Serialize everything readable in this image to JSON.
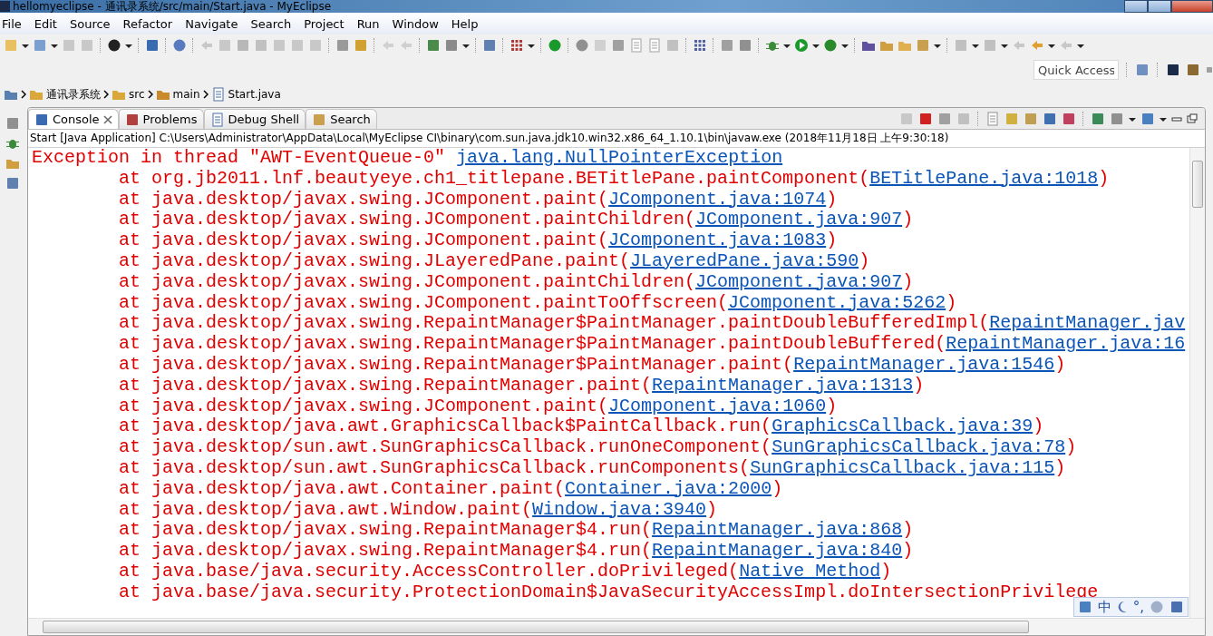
{
  "window": {
    "title": "hellomyeclipse - 通讯录系统/src/main/Start.java - MyEclipse"
  },
  "menu": [
    "File",
    "Edit",
    "Source",
    "Refactor",
    "Navigate",
    "Search",
    "Project",
    "Run",
    "Window",
    "Help"
  ],
  "quick_access": {
    "placeholder": "Quick Access"
  },
  "breadcrumb": [
    "通讯录系统",
    "src",
    "main",
    "Start.java"
  ],
  "tabs": [
    {
      "label": "Console",
      "selected": true,
      "closable": true
    },
    {
      "label": "Problems",
      "selected": false,
      "closable": false
    },
    {
      "label": "Debug Shell",
      "selected": false,
      "closable": false
    },
    {
      "label": "Search",
      "selected": false,
      "closable": false
    }
  ],
  "console": {
    "header": "Start [Java Application] C:\\Users\\Administrator\\AppData\\Local\\MyEclipse CI\\binary\\com.sun.java.jdk10.win32.x86_64_1.10.1\\bin\\javaw.exe (2018年11月18日 上午9:30:18)",
    "lines": [
      {
        "kind": "exception",
        "text": "Exception in thread \"AWT-EventQueue-0\" ",
        "link": "java.lang.NullPointerException"
      },
      {
        "kind": "frame",
        "text": "at org.jb2011.lnf.beautyeye.ch1_titlepane.BETitlePane.paintComponent(",
        "link": "BETitlePane.java:1018",
        "tail": ")"
      },
      {
        "kind": "frame",
        "text": "at java.desktop/javax.swing.JComponent.paint(",
        "link": "JComponent.java:1074",
        "tail": ")"
      },
      {
        "kind": "frame",
        "text": "at java.desktop/javax.swing.JComponent.paintChildren(",
        "link": "JComponent.java:907",
        "tail": ")"
      },
      {
        "kind": "frame",
        "text": "at java.desktop/javax.swing.JComponent.paint(",
        "link": "JComponent.java:1083",
        "tail": ")"
      },
      {
        "kind": "frame",
        "text": "at java.desktop/javax.swing.JLayeredPane.paint(",
        "link": "JLayeredPane.java:590",
        "tail": ")"
      },
      {
        "kind": "frame",
        "text": "at java.desktop/javax.swing.JComponent.paintChildren(",
        "link": "JComponent.java:907",
        "tail": ")"
      },
      {
        "kind": "frame",
        "text": "at java.desktop/javax.swing.JComponent.paintToOffscreen(",
        "link": "JComponent.java:5262",
        "tail": ")"
      },
      {
        "kind": "frame",
        "text": "at java.desktop/javax.swing.RepaintManager$PaintManager.paintDoubleBufferedImpl(",
        "link": "RepaintManager.jav"
      },
      {
        "kind": "frame",
        "text": "at java.desktop/javax.swing.RepaintManager$PaintManager.paintDoubleBuffered(",
        "link": "RepaintManager.java:16"
      },
      {
        "kind": "frame",
        "text": "at java.desktop/javax.swing.RepaintManager$PaintManager.paint(",
        "link": "RepaintManager.java:1546",
        "tail": ")"
      },
      {
        "kind": "frame",
        "text": "at java.desktop/javax.swing.RepaintManager.paint(",
        "link": "RepaintManager.java:1313",
        "tail": ")"
      },
      {
        "kind": "frame",
        "text": "at java.desktop/javax.swing.JComponent.paint(",
        "link": "JComponent.java:1060",
        "tail": ")"
      },
      {
        "kind": "frame",
        "text": "at java.desktop/java.awt.GraphicsCallback$PaintCallback.run(",
        "link": "GraphicsCallback.java:39",
        "tail": ")"
      },
      {
        "kind": "frame",
        "text": "at java.desktop/sun.awt.SunGraphicsCallback.runOneComponent(",
        "link": "SunGraphicsCallback.java:78",
        "tail": ")"
      },
      {
        "kind": "frame",
        "text": "at java.desktop/sun.awt.SunGraphicsCallback.runComponents(",
        "link": "SunGraphicsCallback.java:115",
        "tail": ")"
      },
      {
        "kind": "frame",
        "text": "at java.desktop/java.awt.Container.paint(",
        "link": "Container.java:2000",
        "tail": ")"
      },
      {
        "kind": "frame",
        "text": "at java.desktop/java.awt.Window.paint(",
        "link": "Window.java:3940",
        "tail": ")"
      },
      {
        "kind": "frame",
        "text": "at java.desktop/javax.swing.RepaintManager$4.run(",
        "link": "RepaintManager.java:868",
        "tail": ")"
      },
      {
        "kind": "frame",
        "text": "at java.desktop/javax.swing.RepaintManager$4.run(",
        "link": "RepaintManager.java:840",
        "tail": ")"
      },
      {
        "kind": "frame",
        "text": "at java.base/java.security.AccessController.doPrivileged(",
        "link": "Native Method",
        "tail": ")"
      },
      {
        "kind": "frame",
        "text": "at java.base/java.security.ProtectionDomain$JavaSecurityAccessImpl.doIntersectionPrivilege"
      }
    ]
  },
  "ime": {
    "mode": "中",
    "punct": "°,"
  }
}
